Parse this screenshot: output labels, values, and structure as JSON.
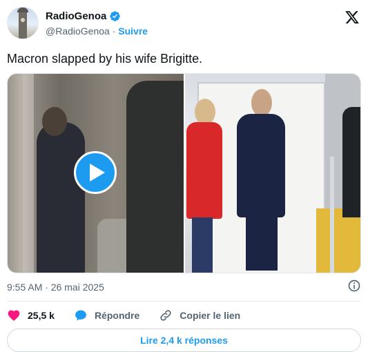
{
  "author": {
    "display_name": "RadioGenoa",
    "handle": "@RadioGenoa",
    "separator": "·",
    "follow_label": "Suivre",
    "verified": true
  },
  "tweet": {
    "text": "Macron slapped by his wife Brigitte.",
    "timestamp": "9:55 AM · 26 mai 2025"
  },
  "actions": {
    "like_count": "25,5 k",
    "reply_label": "Répondre",
    "copy_link_label": "Copier le lien"
  },
  "replies_button_label": "Lire 2,4 k réponses",
  "colors": {
    "accent": "#1d9bf0",
    "like": "#f91880",
    "secondary_text": "#536471"
  },
  "icons": [
    "x-logo-icon",
    "verified-badge-icon",
    "play-icon",
    "info-icon",
    "heart-icon",
    "reply-bubble-icon",
    "link-icon"
  ]
}
